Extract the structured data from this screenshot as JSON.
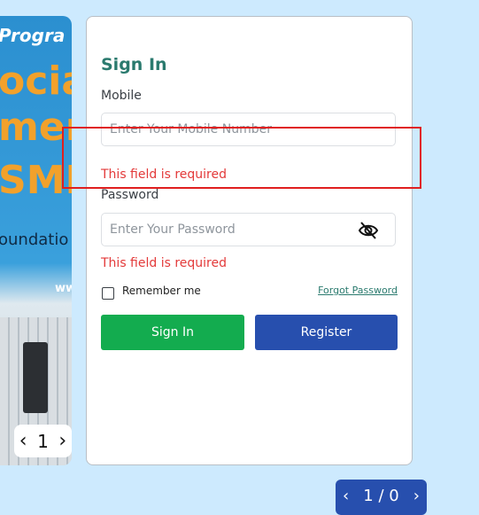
{
  "banner": {
    "line1": "Progra",
    "line2": "ocia",
    "line3": "mer",
    "line4": "SME",
    "line5": "oundatio",
    "line6": "ww"
  },
  "carousel": {
    "prev": "‹",
    "page": "1",
    "next": "›"
  },
  "form": {
    "title": "Sign In",
    "mobile_label": "Mobile",
    "mobile_placeholder": "Enter Your Mobile Number",
    "mobile_error": "This field is required",
    "password_label": "Password",
    "password_placeholder": "Enter Your Password",
    "password_error": "This field is required",
    "remember_label": "Remember me",
    "forgot_label": "Forgot Password",
    "signin_label": "Sign In",
    "register_label": "Register",
    "eye_icon": "eye-off-icon"
  },
  "pager": {
    "prev": "‹",
    "text": "1 / 0",
    "next": "›"
  },
  "colors": {
    "background": "#cdeafe",
    "accent": "#2a7a6e",
    "error": "#e33a3a",
    "signin": "#13ac4f",
    "register": "#274fae"
  }
}
